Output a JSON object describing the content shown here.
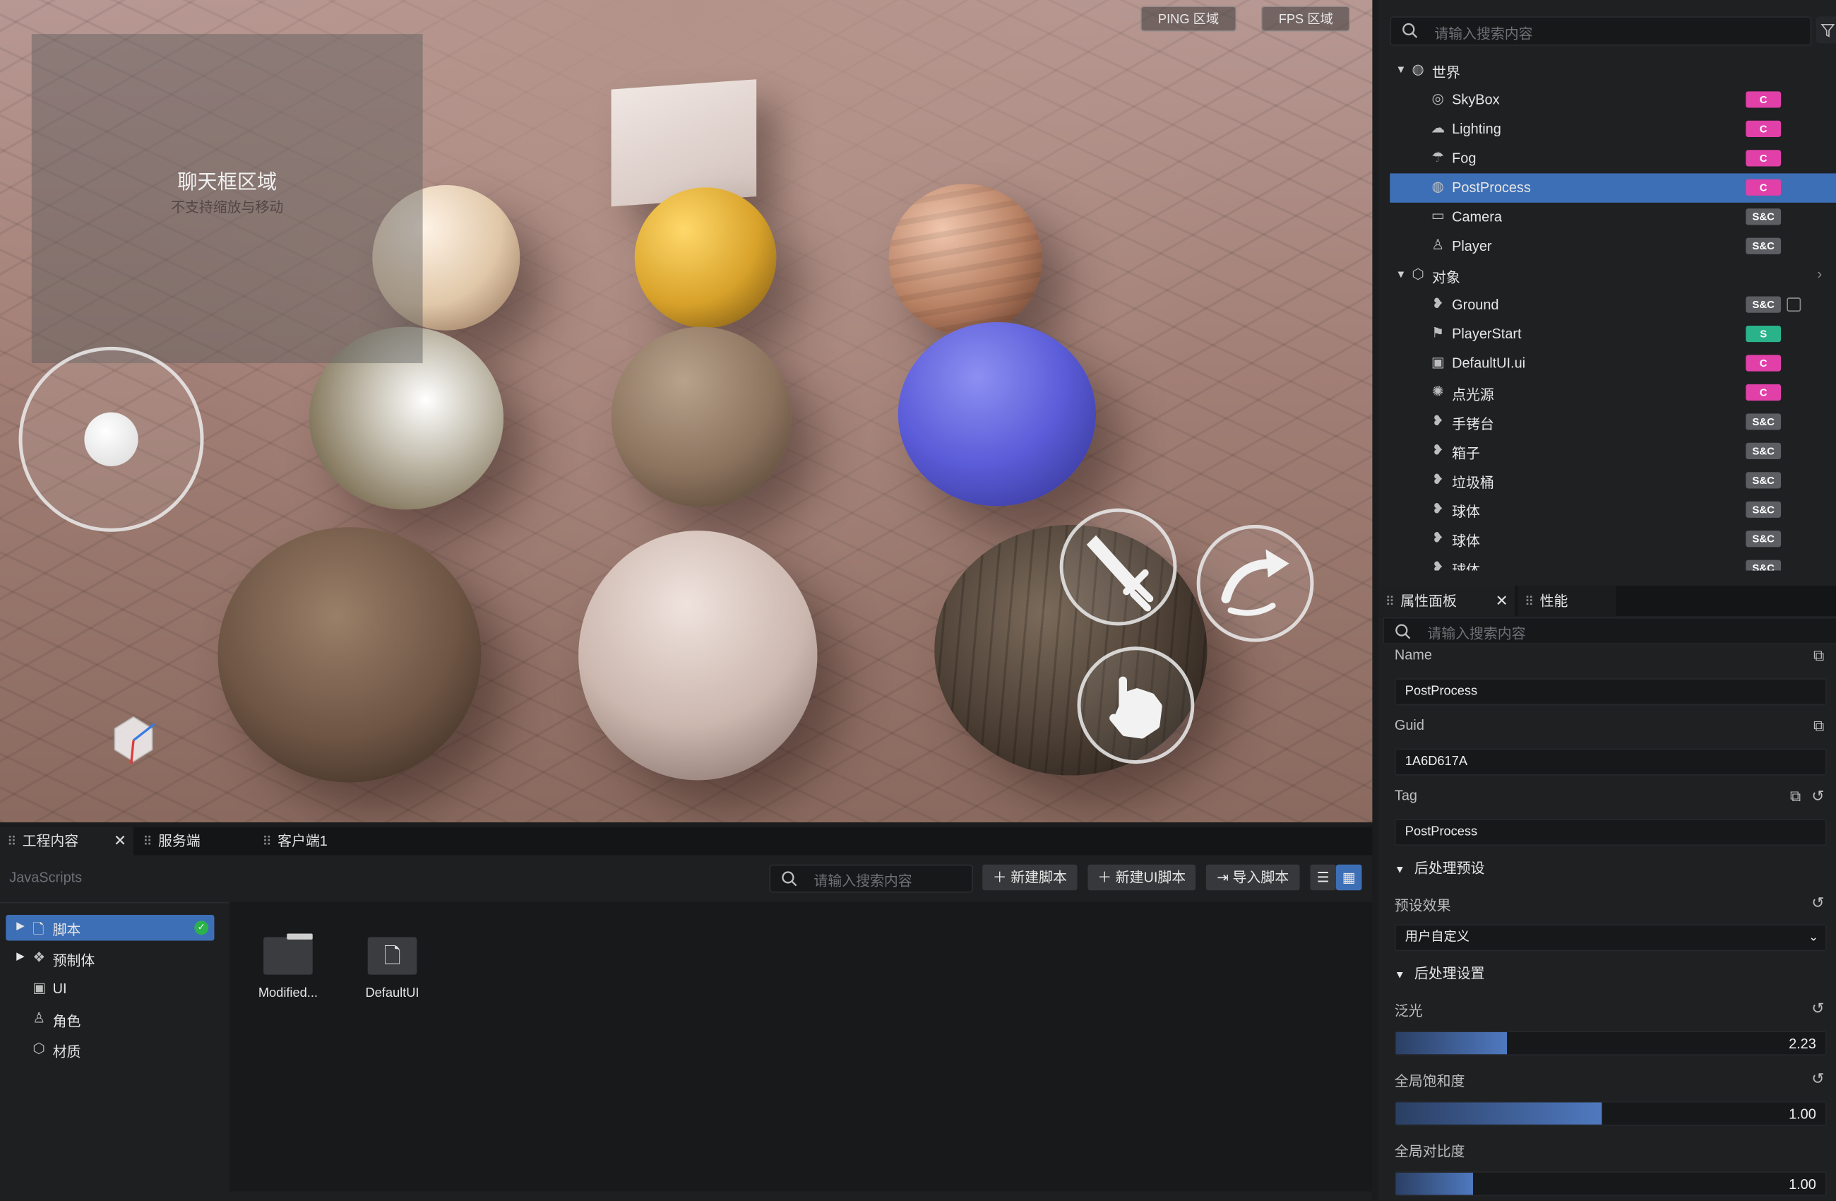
{
  "viewport": {
    "ping_label": "PING 区域",
    "fps_label": "FPS 区域",
    "chat_title": "聊天框区域",
    "chat_subtitle": "不支持缩放与移动"
  },
  "outline": {
    "search_placeholder": "请输入搜索内容",
    "world_label": "世界",
    "objects_label": "对象",
    "world_items": [
      {
        "label": "SkyBox",
        "tag": "C"
      },
      {
        "label": "Lighting",
        "tag": "C"
      },
      {
        "label": "Fog",
        "tag": "C"
      },
      {
        "label": "PostProcess",
        "tag": "C"
      },
      {
        "label": "Camera",
        "tag": "S&C"
      },
      {
        "label": "Player",
        "tag": "S&C"
      }
    ],
    "object_items": [
      {
        "label": "Ground",
        "tag": "S&C"
      },
      {
        "label": "PlayerStart",
        "tag": "S"
      },
      {
        "label": "DefaultUI.ui",
        "tag": "C"
      },
      {
        "label": "点光源",
        "tag": "C"
      },
      {
        "label": "手铐台",
        "tag": "S&C"
      },
      {
        "label": "箱子",
        "tag": "S&C"
      },
      {
        "label": "垃圾桶",
        "tag": "S&C"
      },
      {
        "label": "球体",
        "tag": "S&C"
      },
      {
        "label": "球体",
        "tag": "S&C"
      },
      {
        "label": "球体",
        "tag": "S&C"
      }
    ],
    "selected_index": 3
  },
  "bottom": {
    "tabs": [
      "工程内容",
      "服务端",
      "客户端1"
    ],
    "path": "JavaScripts",
    "search_placeholder": "请输入搜索内容",
    "new_script": "新建脚本",
    "new_ui_script": "新建UI脚本",
    "import_script": "导入脚本",
    "tree": [
      {
        "label": "脚本",
        "selected": true
      },
      {
        "label": "预制体"
      },
      {
        "label": "UI"
      },
      {
        "label": "角色"
      },
      {
        "label": "材质"
      }
    ],
    "files": [
      {
        "label": "Modified...",
        "type": "folder"
      },
      {
        "label": "DefaultUI",
        "type": "file"
      }
    ]
  },
  "properties": {
    "tabs": [
      "属性面板",
      "性能"
    ],
    "search_placeholder": "请输入搜索内容",
    "name_label": "Name",
    "name_value": "PostProcess",
    "guid_label": "Guid",
    "guid_value": "1A6D617A",
    "tag_label": "Tag",
    "tag_value": "PostProcess",
    "preset_section": "后处理预设",
    "preset_label": "预设效果",
    "preset_value": "用户自定义",
    "settings_section": "后处理设置",
    "bloom_label": "泛光",
    "bloom_value": "2.23",
    "bloom_fraction": 0.26,
    "saturation_label": "全局饱和度",
    "saturation_value": "1.00",
    "saturation_fraction": 0.48,
    "contrast_label": "全局对比度",
    "contrast_value": "1.00",
    "contrast_fraction": 0.18
  },
  "colors": {
    "selection": "#3d6fb6",
    "tag_client": "#e040a8",
    "tag_server_client": "#5d5e63",
    "tag_server": "#2ab38b"
  }
}
